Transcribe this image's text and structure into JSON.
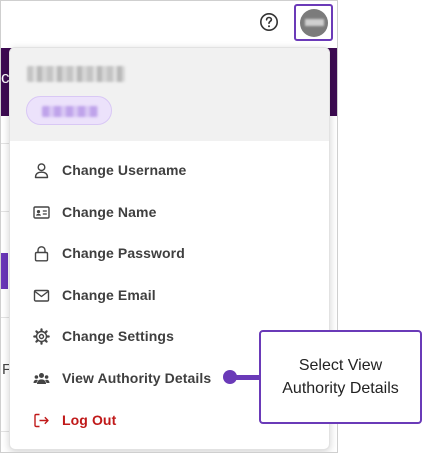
{
  "header": {
    "help_icon": "question-circle-icon",
    "avatar_icon": "user-avatar-icon"
  },
  "background": {
    "partial_text_top": "c",
    "partial_text_mid": "F"
  },
  "account_menu": {
    "items": [
      {
        "label": "Change Username",
        "icon": "user-icon"
      },
      {
        "label": "Change Name",
        "icon": "id-card-icon"
      },
      {
        "label": "Change Password",
        "icon": "lock-icon"
      },
      {
        "label": "Change Email",
        "icon": "envelope-icon"
      },
      {
        "label": "Change Settings",
        "icon": "gear-icon"
      },
      {
        "label": "View Authority Details",
        "icon": "users-icon"
      },
      {
        "label": "Log Out",
        "icon": "logout-icon"
      }
    ]
  },
  "callout": {
    "text": "Select View\nAuthority Details"
  },
  "colors": {
    "accent": "#6a3ab8",
    "header_band": "#3d0b52",
    "logout": "#c01919",
    "menu_text": "#3f3f3f"
  }
}
